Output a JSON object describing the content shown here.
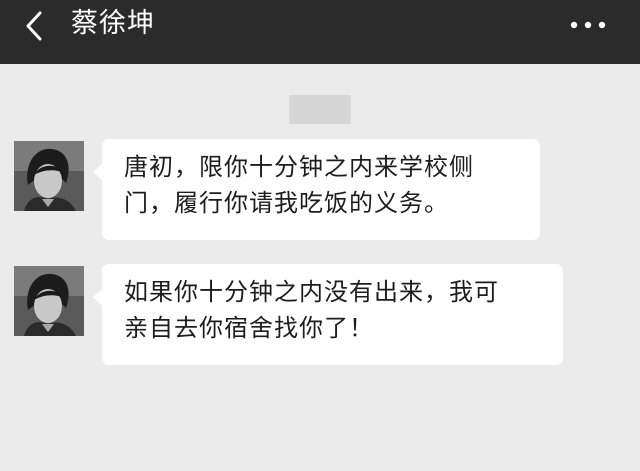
{
  "header": {
    "back_icon": "chevron-left-icon",
    "title": "蔡徐坤",
    "more_icon": "more-dots-icon"
  },
  "colors": {
    "header_bg": "#2b2b2b",
    "chat_bg": "#ebebeb",
    "bubble_bg": "#ffffff",
    "text": "#1d1d1d"
  },
  "messages": [
    {
      "lines": [
        "唐初，限你十分钟之内来学校侧",
        "门，履行你请我吃饭的义务。"
      ]
    },
    {
      "lines": [
        "如果你十分钟之内没有出来，我可",
        "亲自去你宿舍找你了！"
      ]
    }
  ]
}
